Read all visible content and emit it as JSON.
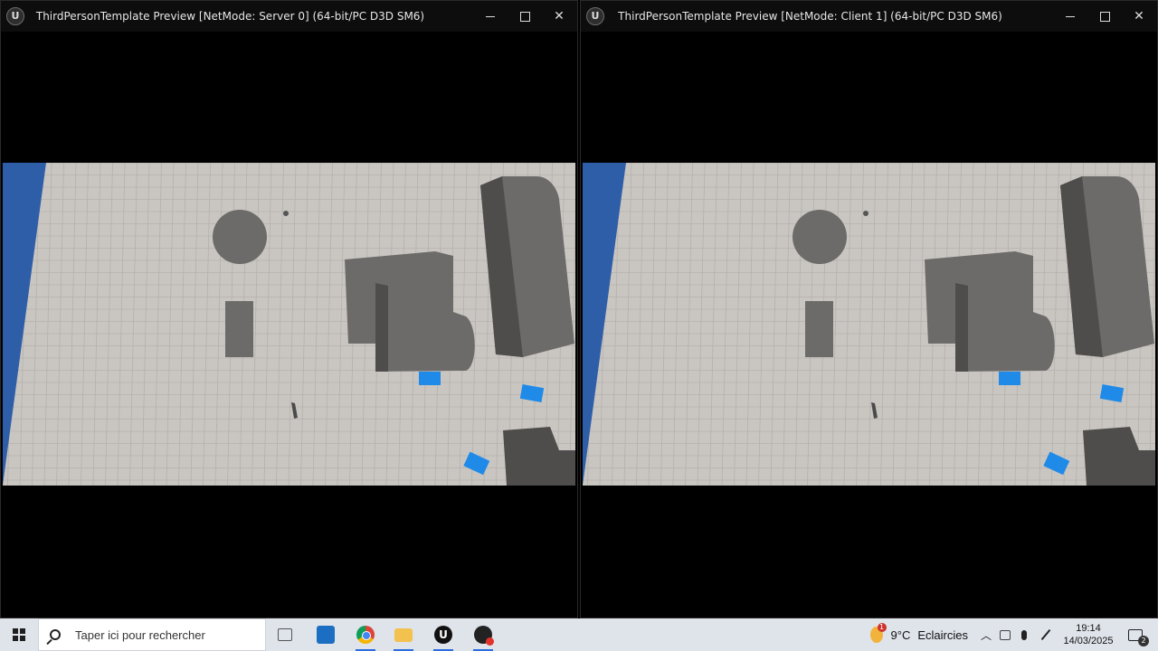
{
  "windows": [
    {
      "title": "ThirdPersonTemplate Preview [NetMode: Server 0]  (64-bit/PC D3D SM6)",
      "controls": {
        "minimize": "minimize",
        "maximize": "maximize",
        "close": "✕"
      }
    },
    {
      "title": "ThirdPersonTemplate Preview [NetMode: Client 1]  (64-bit/PC D3D SM6)",
      "controls": {
        "minimize": "minimize",
        "maximize": "maximize",
        "close": "✕"
      }
    }
  ],
  "scene_colors": {
    "floor": "#c9c6c2",
    "grid": "#b4b1ad",
    "edge_blue": "#2f5ea8",
    "block": "#6d6b69",
    "block_dark": "#4f4d4c",
    "cube_blue": "#1f8ae8"
  },
  "taskbar": {
    "search_placeholder": "Taper ici pour rechercher",
    "apps": [
      "task-view",
      "outlook",
      "chrome",
      "file-explorer",
      "unreal-engine",
      "obs"
    ],
    "weather": {
      "temp": "9°C",
      "condition": "Eclaircies",
      "badge": "1"
    },
    "time": "19:14",
    "date": "14/03/2025",
    "notifications": "2"
  }
}
